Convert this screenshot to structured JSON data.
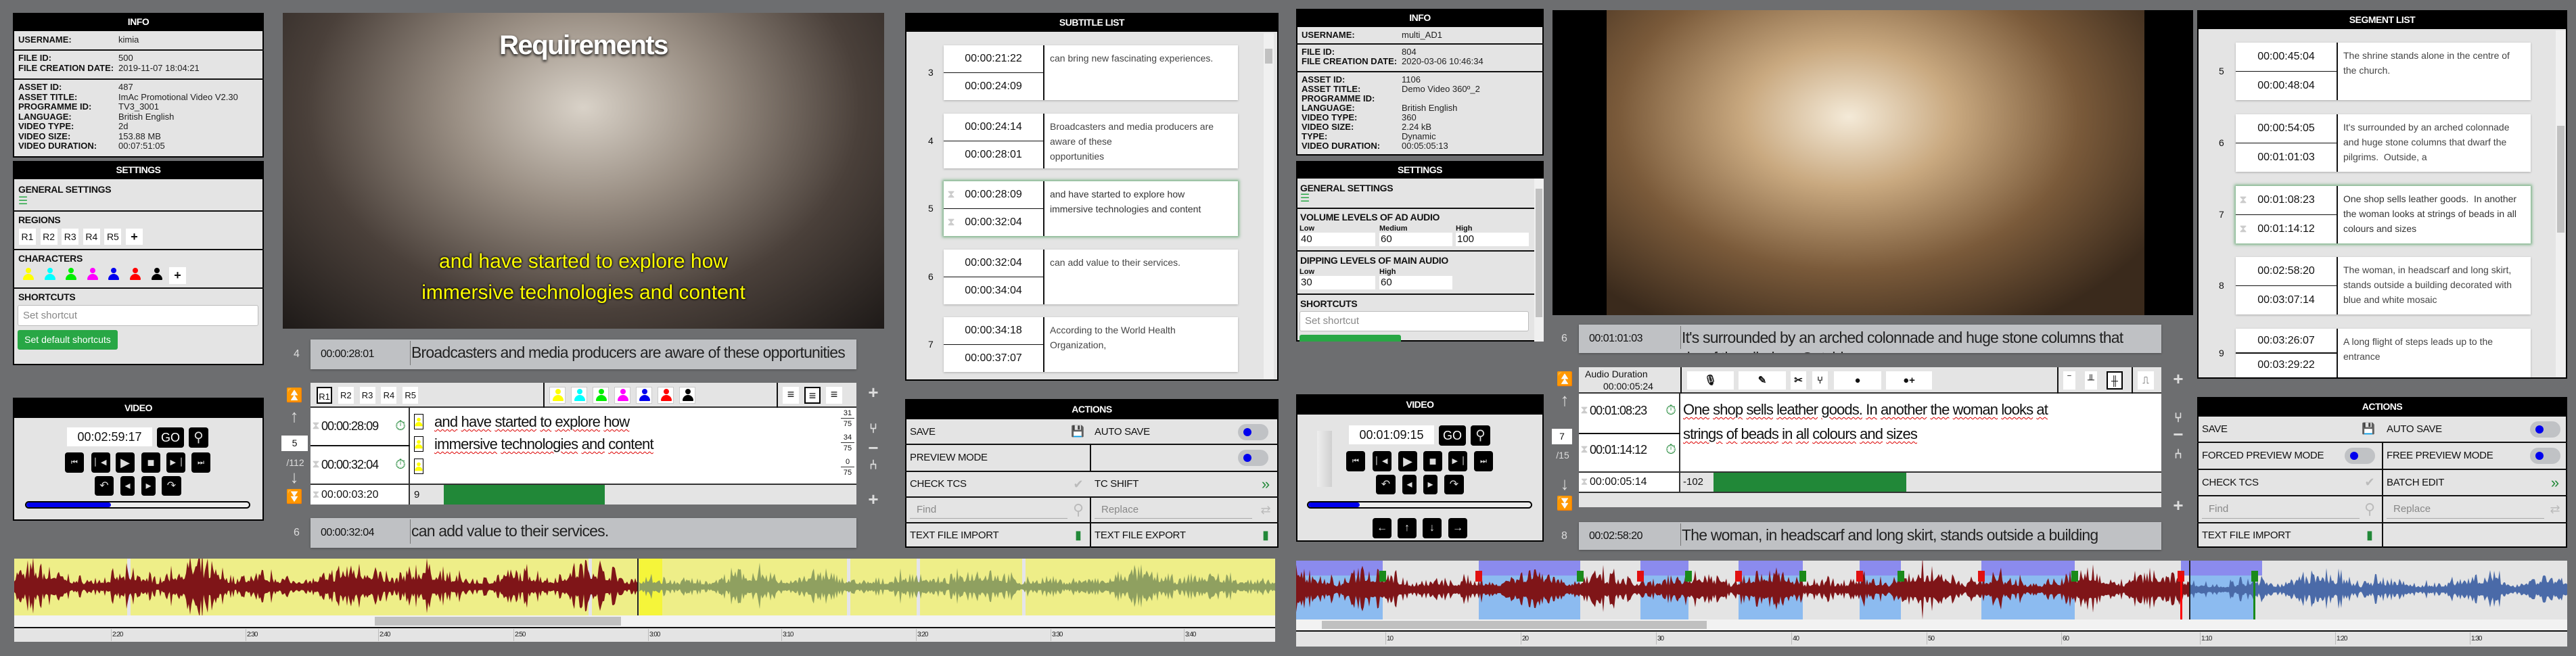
{
  "colors": {
    "accent_green": "#28a745",
    "dark_green": "#218838",
    "toggle_dot": "#0000ee",
    "waveform_played": "#7f1518",
    "waveform_unplayed_left": "#8fa060",
    "waveform_unplayed_right": "#4a6aa8",
    "region_yellow": "#eeee88",
    "segment_blue": "#8cbbf0",
    "segment_purple": "#8b8bee",
    "progress_blue": "#0000ee"
  },
  "characters": [
    "#ffff00",
    "#00ffff",
    "#00ee00",
    "#ff00ff",
    "#0000ee",
    "#ff0000",
    "#000000"
  ],
  "left": {
    "info": {
      "title": "INFO",
      "groups": [
        [
          {
            "label": "USERNAME:",
            "value": "kimia"
          }
        ],
        [
          {
            "label": "FILE ID:",
            "value": "500"
          },
          {
            "label": "FILE CREATION DATE:",
            "value": "2019-11-07 18:04:21"
          }
        ],
        [
          {
            "label": "ASSET ID:",
            "value": "487"
          },
          {
            "label": "ASSET TITLE:",
            "value": "ImAc Promotional Video V2.30"
          },
          {
            "label": "PROGRAMME ID:",
            "value": "TV3_3001"
          },
          {
            "label": "LANGUAGE:",
            "value": "British English"
          },
          {
            "label": "VIDEO TYPE:",
            "value": "2d"
          },
          {
            "label": "VIDEO SIZE:",
            "value": "153.88 MB"
          },
          {
            "label": "VIDEO DURATION:",
            "value": "00:07:51:05"
          }
        ]
      ]
    },
    "settings": {
      "title": "SETTINGS",
      "general": "GENERAL SETTINGS",
      "general_icon": "sliders-icon",
      "regions_label": "REGIONS",
      "regions": [
        "R1",
        "R2",
        "R3",
        "R4",
        "R5",
        "+"
      ],
      "characters_label": "CHARACTERS",
      "add": "+",
      "shortcuts_label": "SHORTCUTS",
      "shortcut_placeholder": "Set shortcut",
      "default_button": "Set default shortcuts"
    },
    "video_panel": {
      "title": "VIDEO",
      "timecode": "00:02:59:17",
      "go": "GO",
      "progress": 0.38
    },
    "video": {
      "title_overlay": "Requirements",
      "subtitle_lines": [
        "and have started to explore how",
        "immersive technologies and content"
      ]
    },
    "editor": {
      "prev": {
        "num": "4",
        "time": "00:00:28:01",
        "text": "Broadcasters and media producers are aware of these opportunities"
      },
      "regions": [
        "R1",
        "R2",
        "R3",
        "R4",
        "R5"
      ],
      "selected_region": "R1",
      "selected_align": "center",
      "index": "5",
      "total": "/112",
      "start": "00:00:28:09",
      "end": "00:00:32:04",
      "lines": [
        "and have started to explore how",
        "immersive technologies and content",
        ""
      ],
      "counters": [
        [
          "31",
          "75"
        ],
        [
          "34",
          "75"
        ],
        [
          "0",
          "75"
        ]
      ],
      "duration": "00:00:03:20",
      "cps": "9",
      "cps_fill": 0.39,
      "next": {
        "num": "6",
        "time": "00:00:32:04",
        "text": "can add value to their services."
      }
    },
    "list": {
      "title": "SUBTITLE LIST",
      "items": [
        {
          "num": "3",
          "start": "00:00:21:22",
          "end": "00:00:24:09",
          "text": "can bring new fascinating experiences."
        },
        {
          "num": "4",
          "start": "00:00:24:14",
          "end": "00:00:28:01",
          "text": "Broadcasters and media producers are aware of these\nopportunities"
        },
        {
          "num": "5",
          "start": "00:00:28:09",
          "end": "00:00:32:04",
          "text": "and have started to explore how\nimmersive technologies and content",
          "active": true
        },
        {
          "num": "6",
          "start": "00:00:32:04",
          "end": "00:00:34:04",
          "text": "can add value to their services."
        },
        {
          "num": "7",
          "start": "00:00:34:18",
          "end": "00:00:37:07",
          "text": "According to the World Health Organization,"
        }
      ]
    },
    "actions": {
      "title": "ACTIONS",
      "save": "SAVE",
      "auto_save": "AUTO SAVE",
      "preview_mode": "PREVIEW MODE",
      "check_tcs": "CHECK TCS",
      "tc_shift": "TC SHIFT",
      "find_placeholder": "Find",
      "replace_placeholder": "Replace",
      "import": "TEXT FILE IMPORT",
      "export": "TEXT FILE EXPORT",
      "auto_save_on": false,
      "preview_on": false
    },
    "timeline": {
      "ticks": [
        "2:20",
        "2:30",
        "2:40",
        "2:50",
        "3:00",
        "3:10",
        "3:20",
        "3:30",
        "3:40"
      ]
    }
  },
  "right": {
    "info": {
      "title": "INFO",
      "groups": [
        [
          {
            "label": "USERNAME:",
            "value": "multi_AD1"
          }
        ],
        [
          {
            "label": "FILE ID:",
            "value": "804"
          },
          {
            "label": "FILE CREATION DATE:",
            "value": "2020-03-06 10:46:34"
          }
        ],
        [
          {
            "label": "ASSET ID:",
            "value": "1106"
          },
          {
            "label": "ASSET TITLE:",
            "value": "Demo Video 360º_2"
          },
          {
            "label": "PROGRAMME ID:",
            "value": ""
          },
          {
            "label": "LANGUAGE:",
            "value": "British English"
          },
          {
            "label": "VIDEO TYPE:",
            "value": "360"
          },
          {
            "label": "VIDEO SIZE:",
            "value": "2.24 kB"
          },
          {
            "label": "TYPE:",
            "value": "Dynamic"
          },
          {
            "label": "VIDEO DURATION:",
            "value": "00:05:05:13"
          }
        ]
      ]
    },
    "settings": {
      "title": "SETTINGS",
      "general": "GENERAL SETTINGS",
      "general_icon": "sliders-icon",
      "volume_label": "VOLUME LEVELS OF AD AUDIO",
      "volume": [
        {
          "label": "Low",
          "value": "40"
        },
        {
          "label": "Medium",
          "value": "60"
        },
        {
          "label": "High",
          "value": "100"
        }
      ],
      "dipping_label": "DIPPING LEVELS OF MAIN AUDIO",
      "dipping": [
        {
          "label": "Low",
          "value": "30"
        },
        {
          "label": "High",
          "value": "60"
        }
      ],
      "shortcuts_label": "SHORTCUTS",
      "shortcut_placeholder": "Set shortcut"
    },
    "video_panel": {
      "title": "VIDEO",
      "timecode": "00:01:09:15",
      "go": "GO",
      "progress": 0.23
    },
    "editor": {
      "prev": {
        "num": "6",
        "time": "00:01:01:03",
        "text": "It's surrounded by an arched colonnade and huge stone columns that dwarf the pilgrims.  Outside, a"
      },
      "audio_duration_label": "Audio Duration",
      "audio_duration": "00:00:05:24",
      "tools": [
        "microphone-icon",
        "magic-wand-icon",
        "scissors-icon",
        "split-icon",
        "play-circle-icon",
        "play-add-icon"
      ],
      "index": "7",
      "total": "/15",
      "start": "00:01:08:23",
      "end": "00:01:14:12",
      "lines": [
        "One shop sells leather goods.  In another the woman looks at",
        "strings of beads in all colours and sizes"
      ],
      "duration": "00:00:05:14",
      "cps": "-102",
      "cps_fill": 0.43,
      "next": {
        "num": "8",
        "time": "00:02:58:20",
        "text": "The woman, in headscarf and long skirt, stands outside a building"
      }
    },
    "list": {
      "title": "SEGMENT LIST",
      "items": [
        {
          "num": "5",
          "start": "00:00:45:04",
          "end": "00:00:48:04",
          "text": "The shrine stands alone in the centre of the church."
        },
        {
          "num": "6",
          "start": "00:00:54:05",
          "end": "00:01:01:03",
          "text": "It's surrounded by an arched colonnade and huge stone columns that dwarf the pilgrims.  Outside, a"
        },
        {
          "num": "7",
          "start": "00:01:08:23",
          "end": "00:01:14:12",
          "text": "One shop sells leather goods.  In another the woman looks at strings of beads in all colours and sizes",
          "active": true
        },
        {
          "num": "8",
          "start": "00:02:58:20",
          "end": "00:03:07:14",
          "text": "The woman, in headscarf and long skirt, stands outside a building decorated with blue and white mosaic"
        },
        {
          "num": "9",
          "start": "00:03:26:07",
          "end": "00:03:29:22",
          "text": "A long flight of steps leads up to the entrance"
        }
      ]
    },
    "actions": {
      "title": "ACTIONS",
      "save": "SAVE",
      "auto_save": "AUTO SAVE",
      "forced_preview": "FORCED PREVIEW MODE",
      "free_preview": "FREE PREVIEW MODE",
      "check_tcs": "CHECK TCS",
      "batch_edit": "BATCH EDIT",
      "find_placeholder": "Find",
      "replace_placeholder": "Replace",
      "import": "TEXT FILE IMPORT"
    },
    "timeline": {
      "ticks": [
        "10",
        "20",
        "30",
        "40",
        "50",
        "60",
        "1:10",
        "1:20",
        "1:30"
      ]
    }
  }
}
